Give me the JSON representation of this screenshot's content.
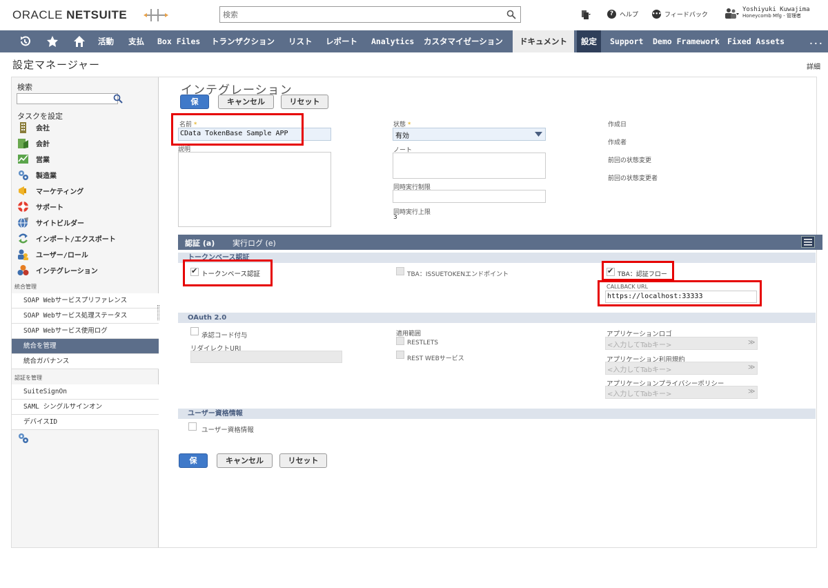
{
  "header": {
    "logo_oracle": "ORACLE",
    "logo_netsuite": "NETSUITE",
    "search_placeholder": "検索",
    "help": "ヘルプ",
    "feedback": "フィードバック",
    "user_name": "Yoshiyuki Kuwajima",
    "user_role": "Honeycomb Mfg - 管理者"
  },
  "nav": {
    "items": [
      "活動",
      "支払",
      "Box Files",
      "トランザクション",
      "リスト",
      "レポート",
      "Analytics",
      "カスタマイゼーション",
      "ドキュメント",
      "設定",
      "Support",
      "Demo Framework",
      "Fixed Assets",
      "..."
    ],
    "icons": [
      "history-icon",
      "star-icon",
      "home-icon"
    ]
  },
  "page": {
    "title": "設定マネージャー",
    "detail_link": "詳細"
  },
  "sidebar": {
    "search_label": "検索",
    "task_label": "タスクを設定",
    "tasks": [
      "会社",
      "会計",
      "営業",
      "製造業",
      "マーケティング",
      "サポート",
      "サイトビルダー",
      "インポート/エクスポート",
      "ユーザー/ロール",
      "インテグレーション"
    ],
    "section1": "統合管理",
    "links1": [
      "SOAP Webサービスプリファレンス",
      "SOAP Webサービス処理ステータス",
      "SOAP Webサービス使用ログ",
      "統合を管理",
      "統合ガバナンス"
    ],
    "section2": "認証を管理",
    "links2": [
      "SuiteSignOn",
      "SAML シングルサインオン",
      "デバイスID"
    ]
  },
  "form": {
    "title": "インテグレーション",
    "save": "保存",
    "cancel": "キャンセル",
    "reset": "リセット",
    "name_label": "名前",
    "required_mark": "*",
    "name_value": "CData TokenBase Sample APP",
    "description_label": "説明",
    "status_label": "状態",
    "status_value": "有効",
    "note_label": "ノート",
    "concurrency_limit_label": "同時実行制限",
    "concurrency_max_label": "同時実行上限",
    "concurrency_max_value": "3",
    "created_date_label": "作成日",
    "created_by_label": "作成者",
    "last_status_change_label": "前回の状態変更",
    "last_status_changer_label": "前回の状態変更者"
  },
  "tabs": {
    "auth": "認証 (a)",
    "exec_log": "実行ログ (e)"
  },
  "token_section": {
    "title": "トークンベース認証",
    "token_auth": "トークンベース認証",
    "tba_issue_token": "TBA：ISSUETOKENエンドポイント",
    "tba_auth_flow": "TBA：認証フロー",
    "callback_label": "CALLBACK URL",
    "callback_value": "https://localhost:33333"
  },
  "oauth_section": {
    "title": "OAuth 2.0",
    "auth_code_grant": "承認コード付与",
    "redirect_uri": "リダイレクトURI",
    "scope_label": "適用範囲",
    "restlets": "RESTLETS",
    "rest_web_services": "REST WEBサービス",
    "app_logo": "アプリケーションロゴ",
    "app_terms": "アプリケーション利用規約",
    "app_privacy": "アプリケーションプライバシーポリシー",
    "tab_placeholder": "<入力してTabキー>"
  },
  "user_cred_section": {
    "title": "ユーザー資格情報",
    "user_cred": "ユーザー資格情報"
  },
  "colors": {
    "nav_bg": "#5c6e8a",
    "primary_button": "#3f79c9",
    "highlight_red": "#e60000"
  }
}
